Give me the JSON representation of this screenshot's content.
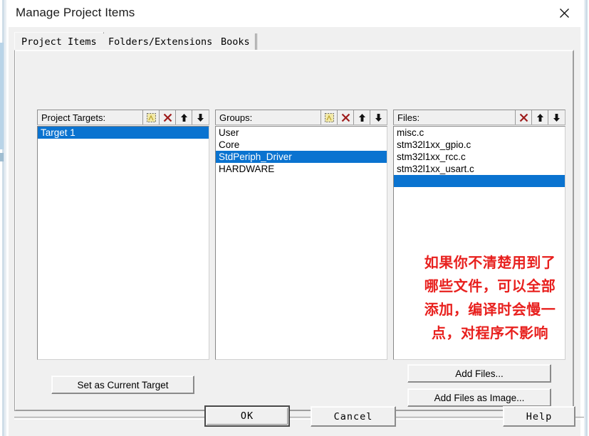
{
  "window": {
    "title": "Manage Project Items",
    "close_icon": "close-icon"
  },
  "tabs": [
    {
      "label": "Project Items",
      "selected": true
    },
    {
      "label": "Folders/Extensions",
      "selected": false
    },
    {
      "label": "Books",
      "selected": false
    }
  ],
  "columns": {
    "targets": {
      "label": "Project Targets:",
      "tools": [
        "new-item-icon",
        "delete-icon",
        "move-up-icon",
        "move-down-icon"
      ],
      "items": [
        {
          "label": "Target 1",
          "selected": true
        }
      ]
    },
    "groups": {
      "label": "Groups:",
      "tools": [
        "new-item-icon",
        "delete-icon",
        "move-up-icon",
        "move-down-icon"
      ],
      "items": [
        {
          "label": "User",
          "selected": false
        },
        {
          "label": "Core",
          "selected": false
        },
        {
          "label": "StdPeriph_Driver",
          "selected": true
        },
        {
          "label": "HARDWARE",
          "selected": false
        }
      ]
    },
    "files": {
      "label": "Files:",
      "tools": [
        "delete-icon",
        "move-up-icon",
        "move-down-icon"
      ],
      "items": [
        {
          "label": "misc.c",
          "selected": false
        },
        {
          "label": "stm32l1xx_gpio.c",
          "selected": false
        },
        {
          "label": "stm32l1xx_rcc.c",
          "selected": false
        },
        {
          "label": "stm32l1xx_usart.c",
          "selected": false
        },
        {
          "label": "",
          "selected": true
        }
      ]
    }
  },
  "annotation": {
    "lines": [
      "如果你不清楚用到了",
      "哪些文件，可以全部",
      "添加，编译时会慢一",
      "点，对程序不影响"
    ],
    "color": "#e8201e"
  },
  "buttons": {
    "set_as_current_target": "Set as Current Target",
    "add_files": "Add Files...",
    "add_files_as_image": "Add Files as Image...",
    "ok": "OK",
    "cancel": "Cancel",
    "help": "Help"
  },
  "colors": {
    "selection_blue": "#0a73d0",
    "dialog_face": "#f0f0f0",
    "delete_icon_red": "#9e1c1c"
  }
}
